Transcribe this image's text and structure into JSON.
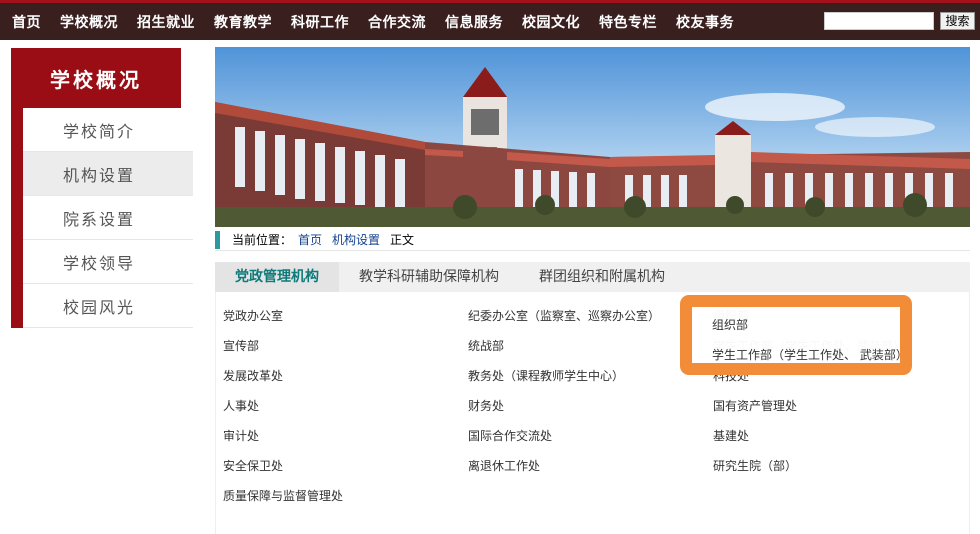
{
  "nav": {
    "items": [
      "首页",
      "学校概况",
      "招生就业",
      "教育教学",
      "科研工作",
      "合作交流",
      "信息服务",
      "校园文化",
      "特色专栏",
      "校友事务"
    ],
    "search_value": "",
    "search_button": "搜索"
  },
  "sidebar": {
    "title": "学校概况",
    "items": [
      "学校简介",
      "机构设置",
      "院系设置",
      "学校领导",
      "校园风光"
    ],
    "active": "机构设置"
  },
  "breadcrumb": {
    "label": "当前位置：",
    "links": [
      "首页",
      "机构设置"
    ],
    "current": "正文"
  },
  "tabs": {
    "items": [
      "党政管理机构",
      "教学科研辅助保障机构",
      "群团组织和附属机构"
    ],
    "active": "党政管理机构"
  },
  "units": {
    "rows": [
      [
        "党政办公室",
        "纪委办公室（监察室、巡察办公室）",
        "组织部"
      ],
      [
        "宣传部",
        "统战部",
        "学生工作部（学生工作处、武装部）"
      ],
      [
        "发展改革处",
        "教务处（课程教师学生中心）",
        "科技处"
      ],
      [
        "人事处",
        "财务处",
        "国有资产管理处"
      ],
      [
        "审计处",
        "国际合作交流处",
        "基建处"
      ],
      [
        "安全保卫处",
        "离退休工作处",
        "研究生院（部）"
      ],
      [
        "质量保障与监督管理处",
        "",
        ""
      ]
    ]
  },
  "highlight": {
    "items": [
      "组织部",
      "学生工作部（学生工作处、 武装部）"
    ],
    "color": "#f28c38"
  },
  "colors": {
    "brand_red": "#9b0d14",
    "nav_bg": "#3a1f1f",
    "teal_accent": "#0e7a7a",
    "link_blue": "#14418f"
  }
}
